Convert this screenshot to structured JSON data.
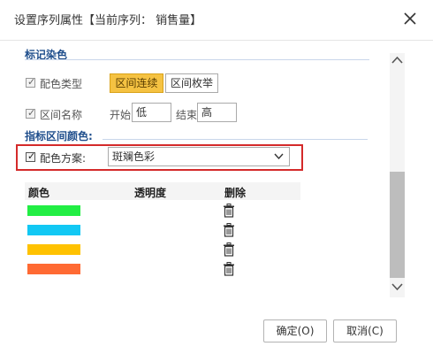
{
  "dialog": {
    "title": "设置序列属性【当前序列： 销售量】",
    "close_icon": "close-icon"
  },
  "section_mark_color": {
    "title": "标记染色",
    "color_type": {
      "label": "配色类型",
      "checked": true,
      "options": [
        "区间连续",
        "区间枚举"
      ],
      "selected": "区间连续"
    },
    "range_name": {
      "label": "区间名称",
      "checked": true,
      "start_label": "开始",
      "start_value": "低",
      "end_label": "结束",
      "end_value": "高"
    }
  },
  "section_indicator_color": {
    "title": "指标区间颜色:",
    "scheme": {
      "label": "配色方案:",
      "checked": true,
      "selected": "斑斓色彩"
    },
    "table": {
      "headers": [
        "颜色",
        "透明度",
        "删除"
      ],
      "rows": [
        {
          "color": "#22ee44",
          "opacity": ""
        },
        {
          "color": "#12c8f4",
          "opacity": ""
        },
        {
          "color": "#ffc200",
          "opacity": ""
        },
        {
          "color": "#ff6a33",
          "opacity": ""
        }
      ]
    }
  },
  "footer": {
    "ok_label": "确定(O)",
    "cancel_label": "取消(C)"
  },
  "colors": {
    "accent": "#f5c242",
    "section_title": "#1f4e8c",
    "highlight_border": "#d42a2a"
  }
}
